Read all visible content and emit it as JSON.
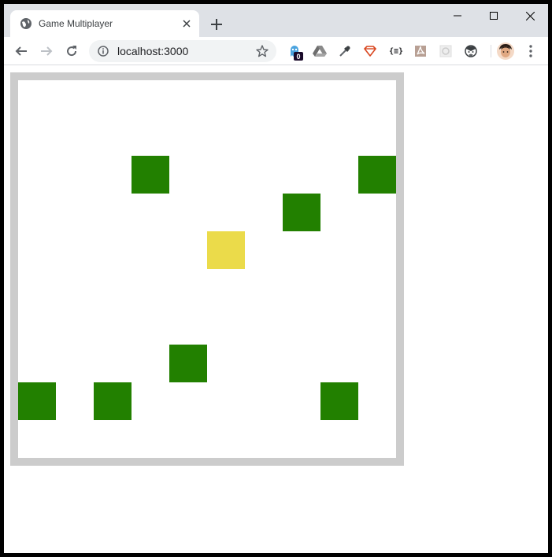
{
  "browser": {
    "tab_title": "Game Multiplayer",
    "tab_icon": "globe-icon",
    "url": "localhost:3000",
    "extension_badge_count": "0",
    "extension_letters": "{≡}"
  },
  "game": {
    "grid_size": 10,
    "border_color": "#cccccc",
    "player_color": "#ebdb4a",
    "other_player_color": "#228000",
    "current_player": {
      "col": 5,
      "row": 4
    },
    "other_players": [
      {
        "col": 3,
        "row": 2
      },
      {
        "col": 9,
        "row": 2
      },
      {
        "col": 7,
        "row": 3
      },
      {
        "col": 4,
        "row": 7
      },
      {
        "col": 0,
        "row": 8
      },
      {
        "col": 2,
        "row": 8
      },
      {
        "col": 8,
        "row": 8
      }
    ]
  }
}
